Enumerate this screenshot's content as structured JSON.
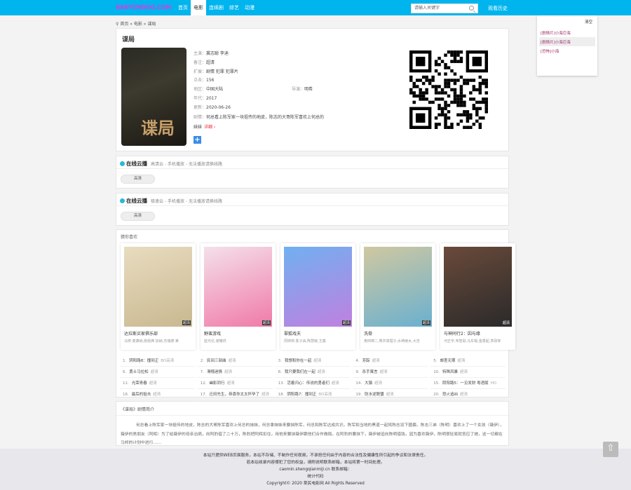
{
  "header": {
    "logo": "BANYUNDOG.COM",
    "nav": [
      "首页",
      "电影",
      "连续剧",
      "综艺",
      "动漫"
    ],
    "active_nav": 1,
    "search_placeholder": "请输入关键字",
    "history_label": "观看历史"
  },
  "history": {
    "clear": "清空",
    "items": [
      "[剧情片]小海巨海",
      "[剧情片]小海巨海",
      "[恐怖]小海"
    ]
  },
  "breadcrumb": [
    "首页",
    "»",
    "电影",
    "»",
    "谍局"
  ],
  "movie": {
    "title": "谍局",
    "fields": [
      {
        "label": "主演：",
        "value": "冀志聪 李迪"
      },
      {
        "label": "备注：",
        "value": "超清"
      },
      {
        "label": "扩展：",
        "value": "剧情 犯罪 犯罪片"
      },
      {
        "label": "点击：",
        "value": "156"
      },
      {
        "label": "地区：",
        "value": "中国大陆",
        "label2": "导演：",
        "value2": "明希"
      },
      {
        "label": "年代：",
        "value": "2017"
      },
      {
        "label": "更新：",
        "value": "2020-06-26"
      }
    ],
    "plot_label": "剧情：",
    "plot_short": "何总看上陈军家一块祖传的地皮，陈志的大哥陈军喜欢上何总的妹妹",
    "more": "详细 ›",
    "cover_text": "谍局"
  },
  "sources": [
    {
      "title": "在线云播",
      "desc": "高清云 - 手机播放 - 无法播放请换线路",
      "button": "高清"
    },
    {
      "title": "在线云播",
      "desc": "极速云 - 手机播放 - 无法播放请换线路",
      "button": "高清"
    }
  ],
  "recommend": {
    "title": "猜你喜欢",
    "badge": "超清",
    "cards": [
      {
        "name": "达拉斯买家俱乐部",
        "actors": "马修·麦康纳,詹妮弗·加纳,杰瑞德·莱",
        "color1": "#c9b890",
        "color2": "#e8dcc0"
      },
      {
        "name": "野蛮游戏",
        "actors": "蓝光伦,谢耀祥",
        "color1": "#f07aa8",
        "color2": "#f4e0ea"
      },
      {
        "name": "翠狐戏夫",
        "actors": "周婷婷,陈子由,陶慧敏,王鑫",
        "color1": "#c080e0",
        "color2": "#70b0f0"
      },
      {
        "name": "洗骨",
        "actors": "奥田瑛二,筒井真理子,水崎绫女,大吉",
        "color1": "#6ab0d0",
        "color2": "#d0c8a0"
      },
      {
        "name": "与神同行2：因与缘",
        "actors": "河正宇,朱智勋,马东锡,金香起,李政宰",
        "color1": "#2a2a2a",
        "color2": "#6a4a3a"
      }
    ],
    "list": [
      {
        "n": "1.",
        "name": "阴阳路8：撞到正",
        "tag": "BD高清"
      },
      {
        "n": "2.",
        "name": "民间三部曲",
        "tag": "超清"
      },
      {
        "n": "3.",
        "name": "我想和你在一起",
        "tag": "超清"
      },
      {
        "n": "4.",
        "name": "芳踪",
        "tag": "超清"
      },
      {
        "n": "5.",
        "name": "邮差无罪",
        "tag": "超清"
      },
      {
        "n": "6.",
        "name": "勇士马拉松",
        "tag": "超清"
      },
      {
        "n": "7.",
        "name": "滑稽迷情",
        "tag": "超清"
      },
      {
        "n": "8.",
        "name": "我只要我们在一起",
        "tag": "超清"
      },
      {
        "n": "9.",
        "name": "杀手寓言",
        "tag": "超清"
      },
      {
        "n": "10.",
        "name": "特殊风暴",
        "tag": "超清"
      },
      {
        "n": "11.",
        "name": "光荣青春",
        "tag": "超清"
      },
      {
        "n": "12.",
        "name": "幽影同行",
        "tag": "超清"
      },
      {
        "n": "13.",
        "name": "活着归心：传说的勇者们",
        "tag": "超清"
      },
      {
        "n": "14.",
        "name": "大猿",
        "tag": "超清"
      },
      {
        "n": "15.",
        "name": "阴阳路5：一见发财 粤语版",
        "tag": "HD"
      },
      {
        "n": "16.",
        "name": "最后的狙击",
        "tag": "超清"
      },
      {
        "n": "17.",
        "name": "迁田先生，恭喜你太太怀孕了",
        "tag": "超清"
      },
      {
        "n": "18.",
        "name": "阴阳路7：撞到正",
        "tag": "BD高清"
      },
      {
        "n": "19.",
        "name": "防水逆联盟",
        "tag": "超清"
      },
      {
        "n": "20.",
        "name": "怒火追凶",
        "tag": "超清"
      }
    ]
  },
  "synopsis": {
    "title": "《谍局》剧情简介",
    "text": "何总看上陈军家一块祖传的地皮，陈志的大哥陈军喜欢上何总的妹妹，何总拿妹妹来要挟陈军，何总和陈军达成共识。陈军和当地的黑道一起将陈志设下圈套。陈志三弟（陈明）喜欢上了一个女孩（薇伊），薇伊的男朋友（阿辉）为了给薇伊的母亲治病，向阿豹借了二十万，陈豹把阿辉扣住，用他来要挟薇伊跟他们合作做局。在阿豹的要挟下，薇伊被迫向陈明借钱，因为喜欢薇伊，陈明很轻易就答应了她，这一切都在马邦的计划中进行……"
  },
  "footer": {
    "lines": [
      "本站只提供WEB页面服务，本站不存储、不制作任何视频，不承担任何由于内容的合法性及健康性所引起的争议和法律责任。",
      "若本站收录内容侵犯了您的权益，请附说明联系邮箱，本站将第一时间处理。",
      "caomin.shengqianmiji.cn 联系邮箱：",
      "统计代码",
      "Copyright© 2020 草民电影网 All Rights Reserved"
    ]
  },
  "colors": {
    "header": "#00b4ed",
    "accent": "#e23"
  }
}
